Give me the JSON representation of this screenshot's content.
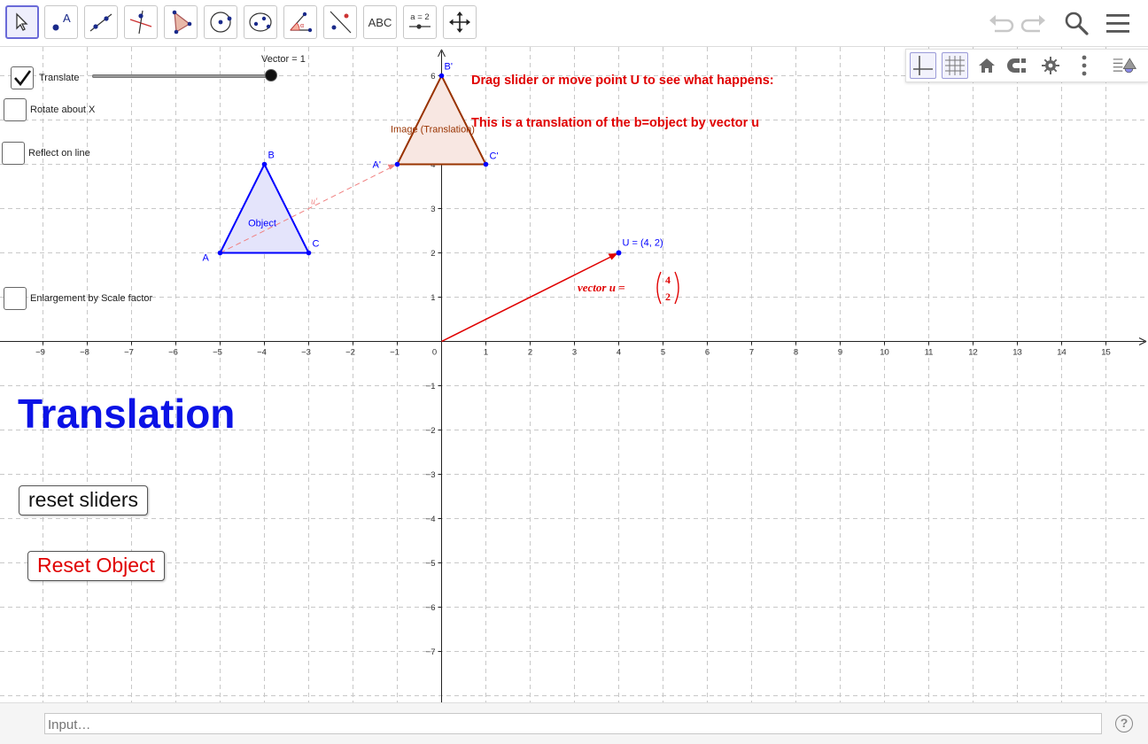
{
  "toolbar": {
    "tools": [
      {
        "name": "move-tool",
        "active": true
      },
      {
        "name": "point-tool",
        "label": "A"
      },
      {
        "name": "line-tool"
      },
      {
        "name": "perpendicular-line-tool"
      },
      {
        "name": "polygon-tool"
      },
      {
        "name": "circle-center-point-tool"
      },
      {
        "name": "ellipse-tool"
      },
      {
        "name": "angle-tool"
      },
      {
        "name": "reflect-tool"
      },
      {
        "name": "text-tool",
        "label": "ABC"
      },
      {
        "name": "slider-tool",
        "label": "a = 2"
      },
      {
        "name": "move-graphics-view-tool"
      }
    ],
    "right": [
      "undo-icon",
      "redo-icon",
      "search-icon",
      "menu-icon"
    ]
  },
  "stylebar": [
    "axes-icon",
    "grid-icon",
    "home-icon",
    "point-capture-icon",
    "settings-icon",
    "more-vertical-icon",
    "toggle-style-bar-icon"
  ],
  "controls": {
    "translate": {
      "label": "Translate",
      "checked": true
    },
    "slider": {
      "caption": "Vector = 1",
      "value": 1,
      "min": 0,
      "max": 1
    },
    "rotate": {
      "label": "Rotate about X",
      "checked": false
    },
    "reflect": {
      "label": "Reflect on line",
      "checked": false
    },
    "enlarge": {
      "label": "Enlargement by Scale factor",
      "checked": false
    }
  },
  "instructions": {
    "line1": "Drag slider or move point U to see what happens:",
    "line2": "This is a translation of the b=object by vector u"
  },
  "title": "Translation",
  "buttons": {
    "reset_sliders": "reset sliders",
    "reset_object": "Reset Object"
  },
  "input": {
    "placeholder": "Input…"
  },
  "help_label": "?",
  "colors": {
    "object": "#0000ff",
    "object_fill": "#e4e4fb",
    "image": "#993300",
    "image_fill": "#f8e7e2",
    "vector": "#e00000",
    "title": "#0b12e6"
  },
  "chart_data": {
    "type": "scatter",
    "title": "",
    "x_ticks": [
      -9,
      -8,
      -7,
      -6,
      -5,
      -4,
      -3,
      -2,
      -1,
      0,
      1,
      2,
      3,
      4,
      5,
      6,
      7,
      8,
      9,
      10,
      11,
      12,
      13,
      14,
      15
    ],
    "y_ticks": [
      -7,
      -6,
      -5,
      -4,
      -3,
      -2,
      -1,
      0,
      1,
      2,
      3,
      4,
      5,
      6
    ],
    "xlim": [
      -9.96,
      16
    ],
    "ylim": [
      -8.14,
      6.66
    ],
    "grid": true,
    "object": {
      "label": "Object",
      "points": [
        {
          "label": "A",
          "x": -5,
          "y": 2
        },
        {
          "label": "B",
          "x": -4,
          "y": 4
        },
        {
          "label": "C",
          "x": -3,
          "y": 2
        }
      ]
    },
    "image": {
      "label": "Image (Translation)",
      "points": [
        {
          "label": "A'",
          "x": -1,
          "y": 4
        },
        {
          "label": "B'",
          "x": 0,
          "y": 6
        },
        {
          "label": "C'",
          "x": 1,
          "y": 4
        }
      ]
    },
    "vector_point": {
      "label": "U = (4, 2)",
      "x": 4,
      "y": 2
    },
    "vector_label": {
      "text": "vector u =",
      "components": [
        "4",
        "2"
      ]
    },
    "translation_vector_label": "u'"
  }
}
